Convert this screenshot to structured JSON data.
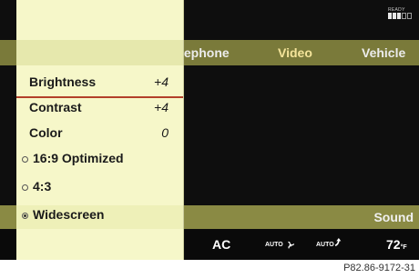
{
  "status": {
    "label": "READY",
    "icon": "signal-bars-icon"
  },
  "main_tabs": [
    {
      "label": "lephone"
    },
    {
      "label": "Video",
      "active": true
    },
    {
      "label": "Vehicle"
    }
  ],
  "sub_bar": {
    "label": "Sound"
  },
  "climate": {
    "ac": "AC",
    "auto_fan": "AUTO",
    "auto_air": "AUTO",
    "temp": "72",
    "temp_unit": "°F"
  },
  "menu": {
    "settings": [
      {
        "label": "Brightness",
        "value": "+4",
        "selected": true
      },
      {
        "label": "Contrast",
        "value": "+4"
      },
      {
        "label": "Color",
        "value": "0"
      }
    ],
    "formats": [
      {
        "label": "16:9 Optimized",
        "checked": false
      },
      {
        "label": "4:3",
        "checked": false
      },
      {
        "label": "Widescreen",
        "checked": true
      }
    ]
  },
  "ref_code": "P82.86-9172-31",
  "colors": {
    "menu_bg": "#f6f7c9",
    "selection": "#b2402a",
    "active_tab": "#f4e49a"
  }
}
